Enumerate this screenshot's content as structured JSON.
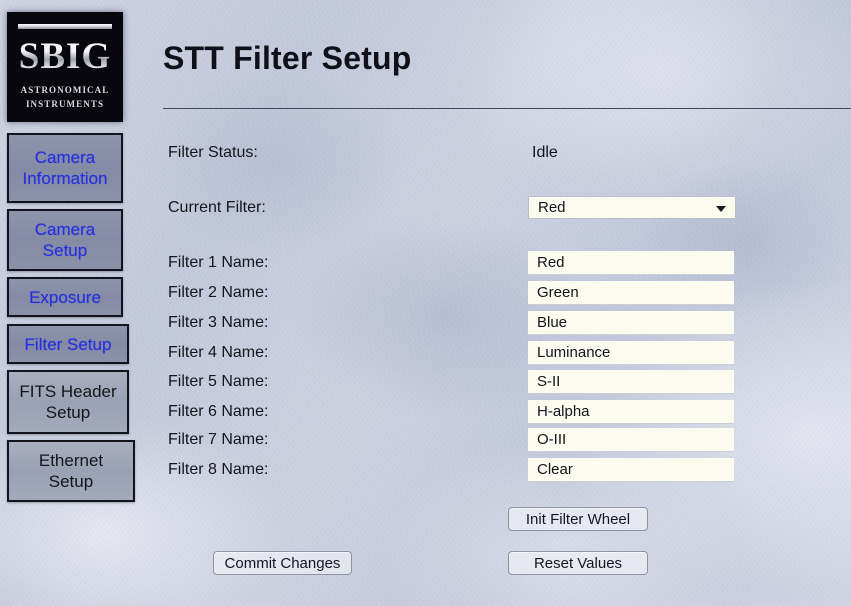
{
  "brand": {
    "name": "SBIG",
    "sub_line1": "ASTRONOMICAL",
    "sub_line2": "INSTRUMENTS"
  },
  "sidebar": {
    "items": [
      {
        "label_line1": "Camera",
        "label_line2": "Information",
        "style": "link"
      },
      {
        "label_line1": "Camera",
        "label_line2": "Setup",
        "style": "link"
      },
      {
        "label_line1": "Exposure",
        "label_line2": "",
        "style": "link"
      },
      {
        "label_line1": "Filter Setup",
        "label_line2": "",
        "style": "link"
      },
      {
        "label_line1": "FITS Header",
        "label_line2": "Setup",
        "style": "plain"
      },
      {
        "label_line1": "Ethernet",
        "label_line2": "Setup",
        "style": "plain"
      }
    ]
  },
  "header": {
    "title": "STT Filter Setup"
  },
  "form": {
    "status_label": "Filter Status:",
    "status_value": "Idle",
    "current_filter_label": "Current Filter:",
    "current_filter_value": "Red",
    "current_filter_options": [
      "Red",
      "Green",
      "Blue",
      "Luminance",
      "S-II",
      "H-alpha",
      "O-III",
      "Clear"
    ],
    "filters": [
      {
        "label": "Filter 1 Name:",
        "value": "Red"
      },
      {
        "label": "Filter 2 Name:",
        "value": "Green"
      },
      {
        "label": "Filter 3 Name:",
        "value": "Blue"
      },
      {
        "label": "Filter 4 Name:",
        "value": "Luminance"
      },
      {
        "label": "Filter 5 Name:",
        "value": "S-II"
      },
      {
        "label": "Filter 6 Name:",
        "value": "H-alpha"
      },
      {
        "label": "Filter 7 Name:",
        "value": "O-III"
      },
      {
        "label": "Filter 8 Name:",
        "value": "Clear"
      }
    ]
  },
  "actions": {
    "init_filter_wheel": "Init Filter Wheel",
    "commit_changes": "Commit Changes",
    "reset_values": "Reset Values"
  },
  "colors": {
    "background": "#c8cdde",
    "link_text": "#2430e0",
    "nav_button_fill": "#9ba1b4",
    "field_fill": "#fbfbef",
    "text": "#14141c"
  }
}
